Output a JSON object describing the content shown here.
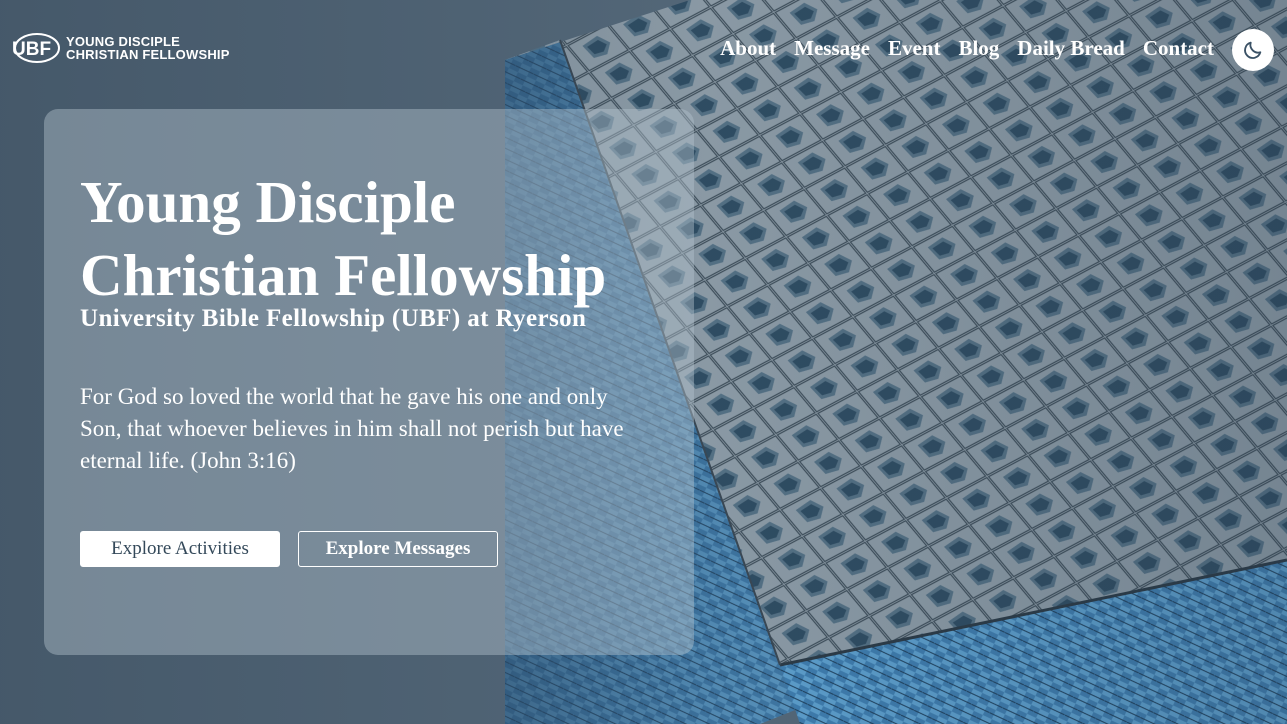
{
  "brand": {
    "mark": "UBF",
    "line1": "YOUNG DISCIPLE",
    "line2": "CHRISTIAN FELLOWSHIP"
  },
  "nav": {
    "items": [
      {
        "label": "About"
      },
      {
        "label": "Message"
      },
      {
        "label": "Event"
      },
      {
        "label": "Blog"
      },
      {
        "label": "Daily Bread"
      },
      {
        "label": "Contact"
      }
    ],
    "theme_toggle_icon": "moon-icon"
  },
  "hero": {
    "title_line1": "Young Disciple",
    "title_line2": "Christian Fellowship",
    "subtitle": "University Bible Fellowship (UBF) at Ryerson",
    "verse_line1": "For God so loved the world that he gave his one and only",
    "verse_line2": "Son, that whoever believes in him shall not perish but have",
    "verse_line3": "eternal life. (John 3:16)",
    "primary_button": "Explore Activities",
    "secondary_button": "Explore Messages"
  },
  "colors": {
    "card_overlay": "#b2c0cc",
    "button_text": "#34495a",
    "moon": "#3a5165"
  }
}
